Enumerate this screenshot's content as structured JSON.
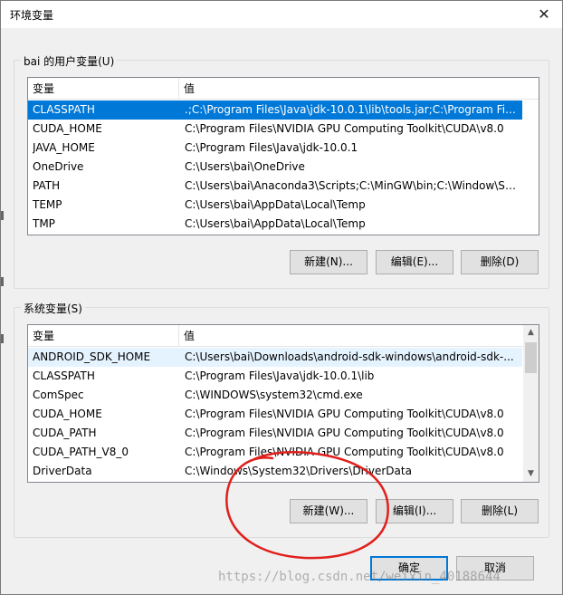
{
  "window": {
    "title": "环境变量",
    "close_glyph": "✕"
  },
  "user_vars": {
    "group_label": "bai 的用户变量(U)",
    "headers": [
      "变量",
      "值"
    ],
    "rows": [
      {
        "name": "CLASSPATH",
        "value": ".;C:\\Program Files\\Java\\jdk-10.0.1\\lib\\tools.jar;C:\\Program Fil...",
        "selected": true
      },
      {
        "name": "CUDA_HOME",
        "value": "C:\\Program Files\\NVIDIA GPU Computing Toolkit\\CUDA\\v8.0"
      },
      {
        "name": "JAVA_HOME",
        "value": "C:\\Program Files\\Java\\jdk-10.0.1"
      },
      {
        "name": "OneDrive",
        "value": "C:\\Users\\bai\\OneDrive"
      },
      {
        "name": "PATH",
        "value": "C:\\Users\\bai\\Anaconda3\\Scripts;C:\\MinGW\\bin;C:\\Window\\Sy..."
      },
      {
        "name": "TEMP",
        "value": "C:\\Users\\bai\\AppData\\Local\\Temp"
      },
      {
        "name": "TMP",
        "value": "C:\\Users\\bai\\AppData\\Local\\Temp"
      }
    ],
    "buttons": {
      "new": "新建(N)...",
      "edit": "编辑(E)...",
      "delete": "删除(D)"
    }
  },
  "system_vars": {
    "group_label": "系统变量(S)",
    "headers": [
      "变量",
      "值"
    ],
    "rows": [
      {
        "name": "ANDROID_SDK_HOME",
        "value": "C:\\Users\\bai\\Downloads\\android-sdk-windows\\android-sdk-...",
        "hover": true
      },
      {
        "name": "CLASSPATH",
        "value": "C:\\Program Files\\Java\\jdk-10.0.1\\lib"
      },
      {
        "name": "ComSpec",
        "value": "C:\\WINDOWS\\system32\\cmd.exe"
      },
      {
        "name": "CUDA_HOME",
        "value": "C:\\Program Files\\NVIDIA GPU Computing Toolkit\\CUDA\\v8.0"
      },
      {
        "name": "CUDA_PATH",
        "value": "C:\\Program Files\\NVIDIA GPU Computing Toolkit\\CUDA\\v8.0"
      },
      {
        "name": "CUDA_PATH_V8_0",
        "value": "C:\\Program Files\\NVIDIA GPU Computing Toolkit\\CUDA\\v8.0"
      },
      {
        "name": "DriverData",
        "value": "C:\\Windows\\System32\\Drivers\\DriverData"
      }
    ],
    "buttons": {
      "new": "新建(W)...",
      "edit": "编辑(I)...",
      "delete": "删除(L)"
    }
  },
  "footer": {
    "ok": "确定",
    "cancel": "取消"
  },
  "watermark": "https://blog.csdn.net/weixin_40188644",
  "colors": {
    "selection": "#0078d7",
    "hover": "#e5f3ff",
    "annotation": "#e0201c"
  }
}
